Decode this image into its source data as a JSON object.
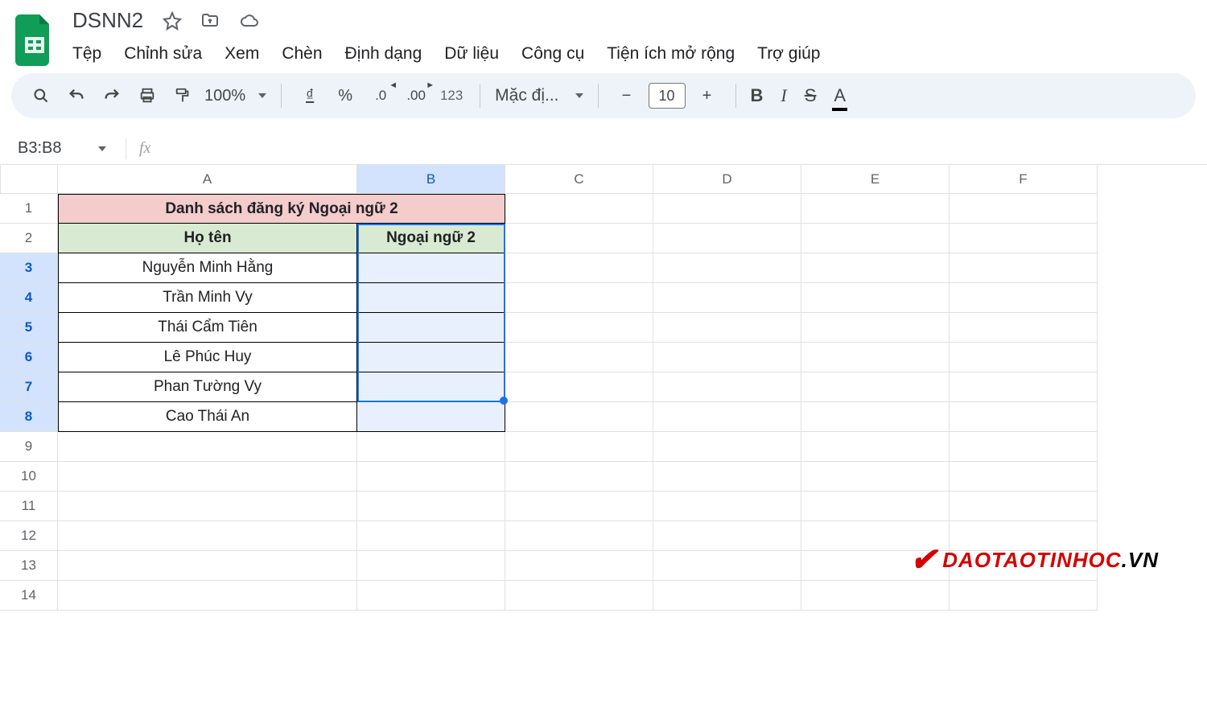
{
  "doc": {
    "title": "DSNN2"
  },
  "menubar": [
    "Tệp",
    "Chỉnh sửa",
    "Xem",
    "Chèn",
    "Định dạng",
    "Dữ liệu",
    "Công cụ",
    "Tiện ích mở rộng",
    "Trợ giúp"
  ],
  "toolbar": {
    "zoom": "100%",
    "currency": "₫",
    "percent": "%",
    "dec_dec": ".0",
    "dec_inc": ".00",
    "num123": "123",
    "font": "Mặc đị...",
    "minus": "−",
    "plus": "+",
    "font_size": "10",
    "bold": "B",
    "italic": "I",
    "strike": "S",
    "textcolor": "A"
  },
  "namebox": "B3:B8",
  "columns": [
    "A",
    "B",
    "C",
    "D",
    "E",
    "F"
  ],
  "rows": [
    "1",
    "2",
    "3",
    "4",
    "5",
    "6",
    "7",
    "8",
    "9",
    "10",
    "11",
    "12",
    "13",
    "14"
  ],
  "sheet": {
    "title": "Danh sách đăng ký Ngoại ngữ 2",
    "header_a": "Họ tên",
    "header_b": "Ngoại ngữ 2",
    "names": [
      "Nguyễn Minh Hằng",
      "Trần Minh Vy",
      "Thái Cẩm Tiên",
      "Lê Phúc Huy",
      "Phan Tường Vy",
      "Cao Thái An"
    ]
  },
  "watermark": {
    "brand1": "DAOTAOTINHOC",
    "brand2": ".VN"
  }
}
